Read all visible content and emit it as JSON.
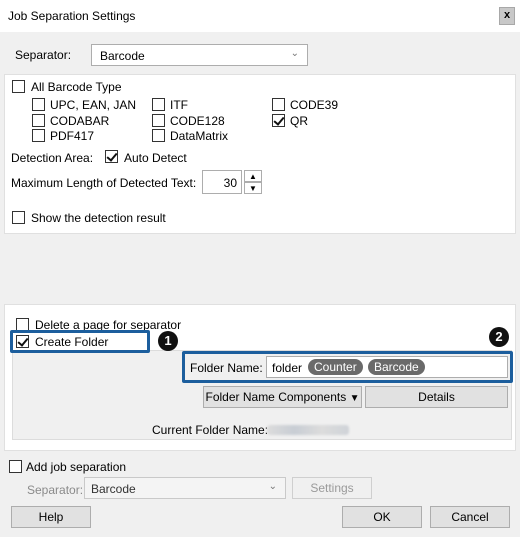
{
  "window": {
    "title": "Job Separation Settings",
    "close_glyph": "x"
  },
  "separator": {
    "label": "Separator:",
    "value": "Barcode"
  },
  "barcode": {
    "all_label": "All Barcode Type",
    "types": [
      {
        "label": "UPC, EAN, JAN",
        "checked": false
      },
      {
        "label": "ITF",
        "checked": false
      },
      {
        "label": "CODE39",
        "checked": false
      },
      {
        "label": "CODABAR",
        "checked": false
      },
      {
        "label": "CODE128",
        "checked": false
      },
      {
        "label": "QR",
        "checked": true
      },
      {
        "label": "PDF417",
        "checked": false
      },
      {
        "label": "DataMatrix",
        "checked": false
      }
    ],
    "detection_area_label": "Detection Area:",
    "auto_detect_label": "Auto Detect",
    "max_length_label": "Maximum Length of Detected Text:",
    "max_length_value": "30",
    "show_result_label": "Show the detection result"
  },
  "folder": {
    "delete_page_label": "Delete a page for separator",
    "create_folder_label": "Create Folder",
    "folder_name_label": "Folder Name:",
    "folder_name_prefix": "folder",
    "chips": [
      "Counter",
      "Barcode"
    ],
    "components_button": "Folder Name Components",
    "components_arrow": "▼",
    "details_button": "Details",
    "current_label": "Current Folder Name:"
  },
  "callouts": {
    "one": "1",
    "two": "2"
  },
  "add_job": {
    "label": "Add job separation",
    "separator_label": "Separator:",
    "separator_value": "Barcode",
    "settings_button": "Settings"
  },
  "footer": {
    "help": "Help",
    "ok": "OK",
    "cancel": "Cancel"
  },
  "colors": {
    "highlight": "#1c5e9d"
  }
}
